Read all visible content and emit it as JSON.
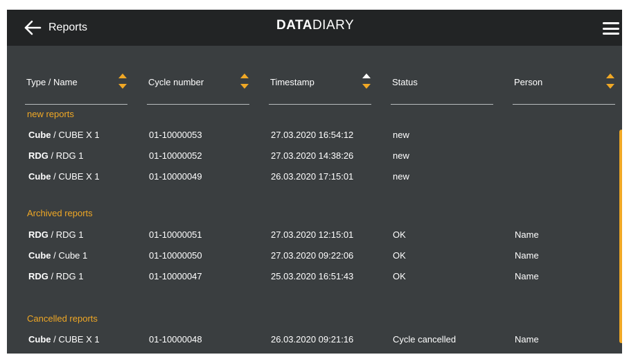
{
  "header": {
    "title": "Reports",
    "logo_bold": "DATA",
    "logo_light": "DIARY"
  },
  "icons": {
    "back": "arrow-left-icon",
    "menu": "hamburger-menu-icon",
    "sort": "sort-arrows-icon"
  },
  "columns": [
    {
      "label": "Type / Name"
    },
    {
      "label": "Cycle number"
    },
    {
      "label": "Timestamp"
    },
    {
      "label": "Status"
    },
    {
      "label": "Person"
    }
  ],
  "sections": [
    {
      "title": "new reports",
      "rows": [
        {
          "type": "Cube",
          "name": " / CUBE X 1",
          "cycle": "01-10000053",
          "timestamp": "27.03.2020 16:54:12",
          "status": "new",
          "person": ""
        },
        {
          "type": "RDG",
          "name": " / RDG 1",
          "cycle": "01-10000052",
          "timestamp": "27.03.2020 14:38:26",
          "status": "new",
          "person": ""
        },
        {
          "type": "Cube",
          "name": " / CUBE X 1",
          "cycle": "01-10000049",
          "timestamp": "26.03.2020 17:15:01",
          "status": "new",
          "person": ""
        }
      ]
    },
    {
      "title": "Archived reports",
      "rows": [
        {
          "type": "RDG",
          "name": " / RDG 1",
          "cycle": "01-10000051",
          "timestamp": "27.03.2020 12:15:01",
          "status": "OK",
          "person": "Name"
        },
        {
          "type": "Cube",
          "name": " / Cube 1",
          "cycle": "01-10000050",
          "timestamp": "27.03.2020 09:22:06",
          "status": "OK",
          "person": "Name"
        },
        {
          "type": "RDG",
          "name": " / RDG 1",
          "cycle": "01-10000047",
          "timestamp": "25.03.2020 16:51:43",
          "status": "OK",
          "person": "Name"
        }
      ]
    },
    {
      "title": "Cancelled reports",
      "rows": [
        {
          "type": "Cube",
          "name": " / CUBE X 1",
          "cycle": "01-10000048",
          "timestamp": "26.03.2020 09:21:16",
          "status": "Cycle cancelled",
          "person": "Name"
        }
      ]
    }
  ],
  "colors": {
    "accent": "#f0a825",
    "header_bg": "#222425",
    "body_bg": "#3a3e40"
  }
}
